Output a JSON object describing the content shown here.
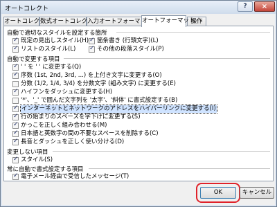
{
  "window": {
    "title": "オートコレクト",
    "help_label": "?",
    "close_label": "×"
  },
  "tabs": [
    {
      "label": "オートコレクト",
      "active": false
    },
    {
      "label": "数式オートコレクト",
      "active": false
    },
    {
      "label": "入力オートフォーマット",
      "active": false
    },
    {
      "label": "オートフォーマット",
      "active": true
    },
    {
      "label": "操作",
      "active": false
    }
  ],
  "sections": {
    "auto_style": "自動で適切なスタイルを設定する箇所",
    "auto_change": "自動で変更する項目",
    "preserve": "変更しない項目",
    "always": "常に自動で書式設定する項目"
  },
  "auto_style_items": [
    {
      "label": "既定の見出しスタイル(H)",
      "checked": true
    },
    {
      "label": "箇条書き (行頭文字)(L)",
      "checked": true
    },
    {
      "label": "リストのスタイル(L)",
      "checked": true
    },
    {
      "label": "その他の段落スタイル(P)",
      "checked": true
    }
  ],
  "auto_change_items": [
    {
      "label": "' ' を ' ' に変更する(Q)",
      "checked": true
    },
    {
      "label": "序数 (1st, 2nd, 3rd, ...) を上付き文字に変更する(O)",
      "checked": true
    },
    {
      "label": "分数 (1/2, 1/4, 3/4) を分数文字 (組み文字) に変更する(E)",
      "checked": false
    },
    {
      "label": "ハイフンをダッシュに変更する(H)",
      "checked": true
    },
    {
      "label": "'*'、'_' で囲んだ文字列を '太字'、'斜体' に書式設定する(B)",
      "checked": false
    },
    {
      "label": "インターネットとネットワークのアドレスをハイパーリンクに変更する(I)",
      "checked": true,
      "focus": true
    },
    {
      "label": "行の始まりのスペースを字下げに変更する(S)",
      "checked": true
    },
    {
      "label": "かっこを正しく組み合わせる(M)",
      "checked": true
    },
    {
      "label": "日本語と英数字の間の不要なスペースを削除する(C)",
      "checked": true
    },
    {
      "label": "長音とダッシュを正しく使い分ける(D)",
      "checked": true
    }
  ],
  "preserve_items": [
    {
      "label": "スタイル(S)",
      "checked": true
    }
  ],
  "always_items": [
    {
      "label": "電子メール経由で受信したメッセージ(T)",
      "checked": true
    }
  ],
  "buttons": {
    "ok": "OK",
    "cancel": "キャンセル"
  },
  "colors": {
    "highlight": "#e0222a",
    "title_bar": "#cfdcec"
  }
}
